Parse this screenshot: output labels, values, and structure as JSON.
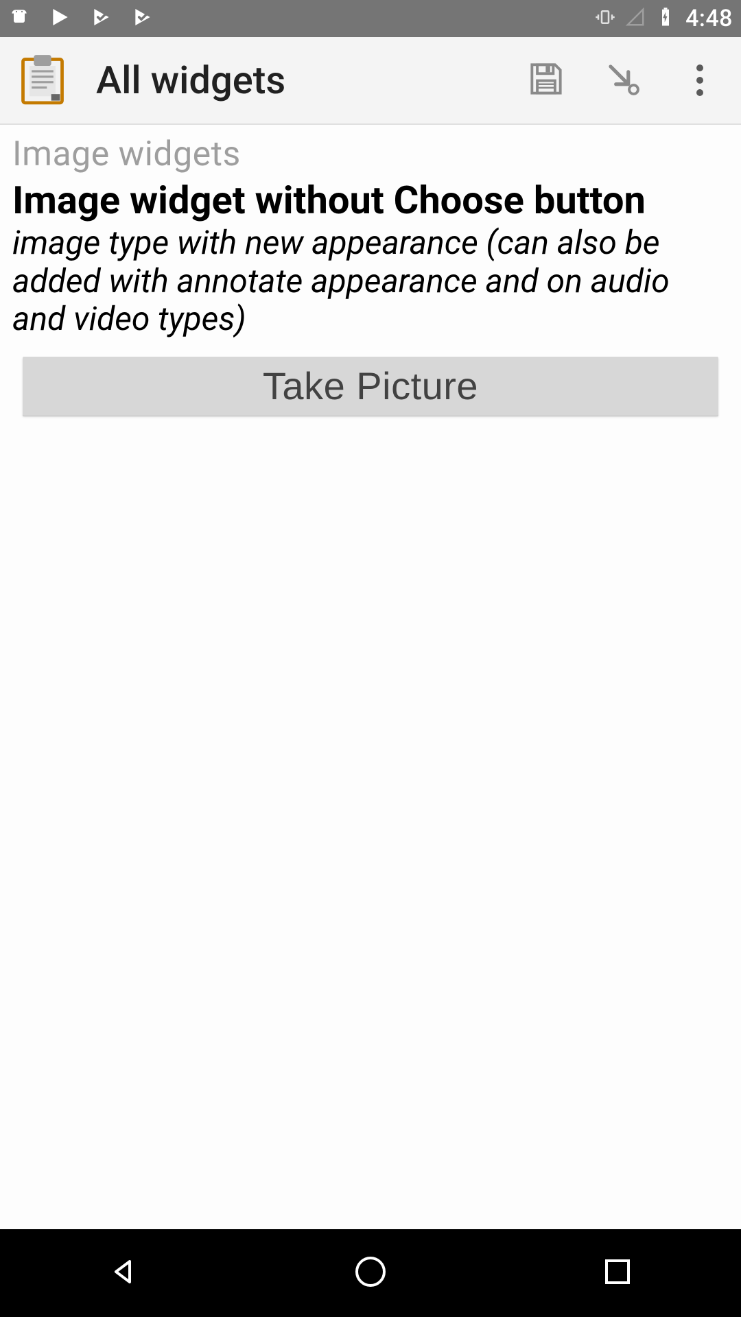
{
  "status_bar": {
    "time": "4:48"
  },
  "app_bar": {
    "title": "All widgets"
  },
  "section": {
    "header": "Image widgets"
  },
  "question": {
    "title": "Image widget without Choose button",
    "hint": "image type with new appearance (can also be added with annotate appearance and on audio and video types)"
  },
  "actions": {
    "take_picture": "Take Picture"
  }
}
